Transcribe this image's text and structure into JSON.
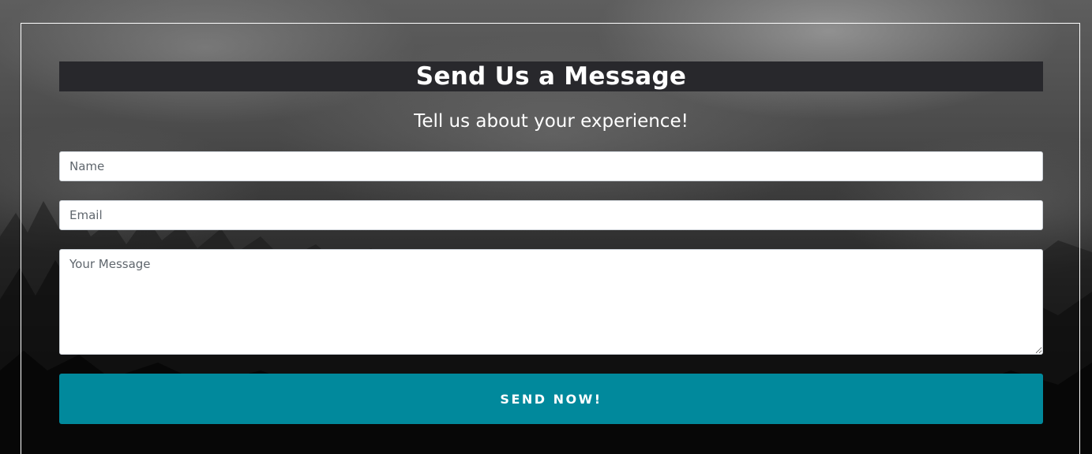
{
  "form": {
    "title": "Send Us a Message",
    "subtitle": "Tell us about your experience!",
    "name_placeholder": "Name",
    "email_placeholder": "Email",
    "message_placeholder": "Your Message",
    "submit_label": "SEND NOW!"
  },
  "colors": {
    "title_bar": "#28282c",
    "button": "#01899c",
    "frame_border": "#ffffff",
    "text": "#ffffff"
  }
}
